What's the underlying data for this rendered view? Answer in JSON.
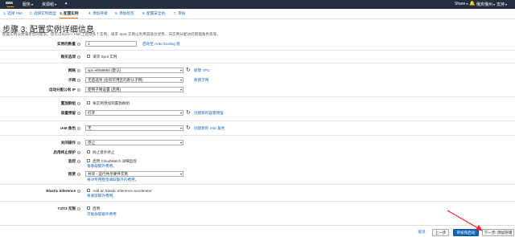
{
  "nav": {
    "logo": "aws",
    "services": "服务",
    "resource_groups": "资源组",
    "user": "Share",
    "region": "俄亥俄州",
    "support": "支持"
  },
  "steps": [
    {
      "label": "1. 选择 AMI",
      "active": false
    },
    {
      "label": "2. 选择实例类型",
      "active": false
    },
    {
      "label": "3. 配置实例",
      "active": true
    },
    {
      "label": "4. 添加存储",
      "active": false
    },
    {
      "label": "5. 添加标签",
      "active": false
    },
    {
      "label": "6. 配置安全组",
      "active": false
    },
    {
      "label": "7. 审核",
      "active": false
    }
  ],
  "page": {
    "title": "步骤 3: 配置实例详细信息",
    "description": "配置实例以便满足您的需求。您可以从同一 AMI 上启动多个实例，请求 Spot 实例以利用其低价优势，向实例分配访问管理角色等等。"
  },
  "form": {
    "instance_count": {
      "label": "实例的数量",
      "value": "1",
      "link": "启动至 Auto Scaling 组"
    },
    "purchase_option": {
      "label": "购买选项",
      "checkbox": "请求 Spot 实例"
    },
    "network": {
      "label": "网络",
      "value": "vpc-ef558884 (默认)",
      "link": "新建 VPC"
    },
    "subnet": {
      "label": "子网",
      "value": "无首选项 (任何可用区的默认子网)",
      "link": "新建子网"
    },
    "public_ip": {
      "label": "自动分配公有 IP",
      "value": "使用子网设置 (启用)"
    },
    "placement_group": {
      "label": "置放群组",
      "checkbox": "将实例添加到置放群组"
    },
    "capacity_reservation": {
      "label": "容量预留",
      "value": "打开",
      "link": "创建新的容量预留"
    },
    "iam_role": {
      "label": "IAM 角色",
      "value": "无",
      "link": "创建新的 IAM 角色"
    },
    "shutdown_behavior": {
      "label": "关闭操作",
      "value": "停止"
    },
    "termination_protection": {
      "label": "启用终止保护",
      "checkbox": "防止意外终止"
    },
    "monitoring": {
      "label": "监控",
      "checkbox": "启用 CloudWatch 详细监控",
      "sub": "将收取额外费用。"
    },
    "tenancy": {
      "label": "租赁",
      "value": "共享 - 运行共享硬件实例",
      "sub": "将对专用租赁收取额外的费用。"
    },
    "elastic_inference": {
      "label": "Elastic Inference",
      "checkbox": "Add an Elastic Inference accelerator",
      "sub": "将收取额外费用。"
    },
    "t2t3_unlimited": {
      "label": "T2/T3 无限",
      "checkbox": "启用",
      "sub": "可能收取额外费用"
    }
  },
  "footer": {
    "cancel": "取消",
    "prev": "上一步",
    "review": "审核和启动",
    "next": "下一步: 添加存储"
  },
  "colors": {
    "navbar": "#232f3e",
    "link": "#1166bb",
    "primary_button": "#1166bb",
    "annotation_arrow": "#e8242a",
    "active_step_underline": "#e47911"
  }
}
